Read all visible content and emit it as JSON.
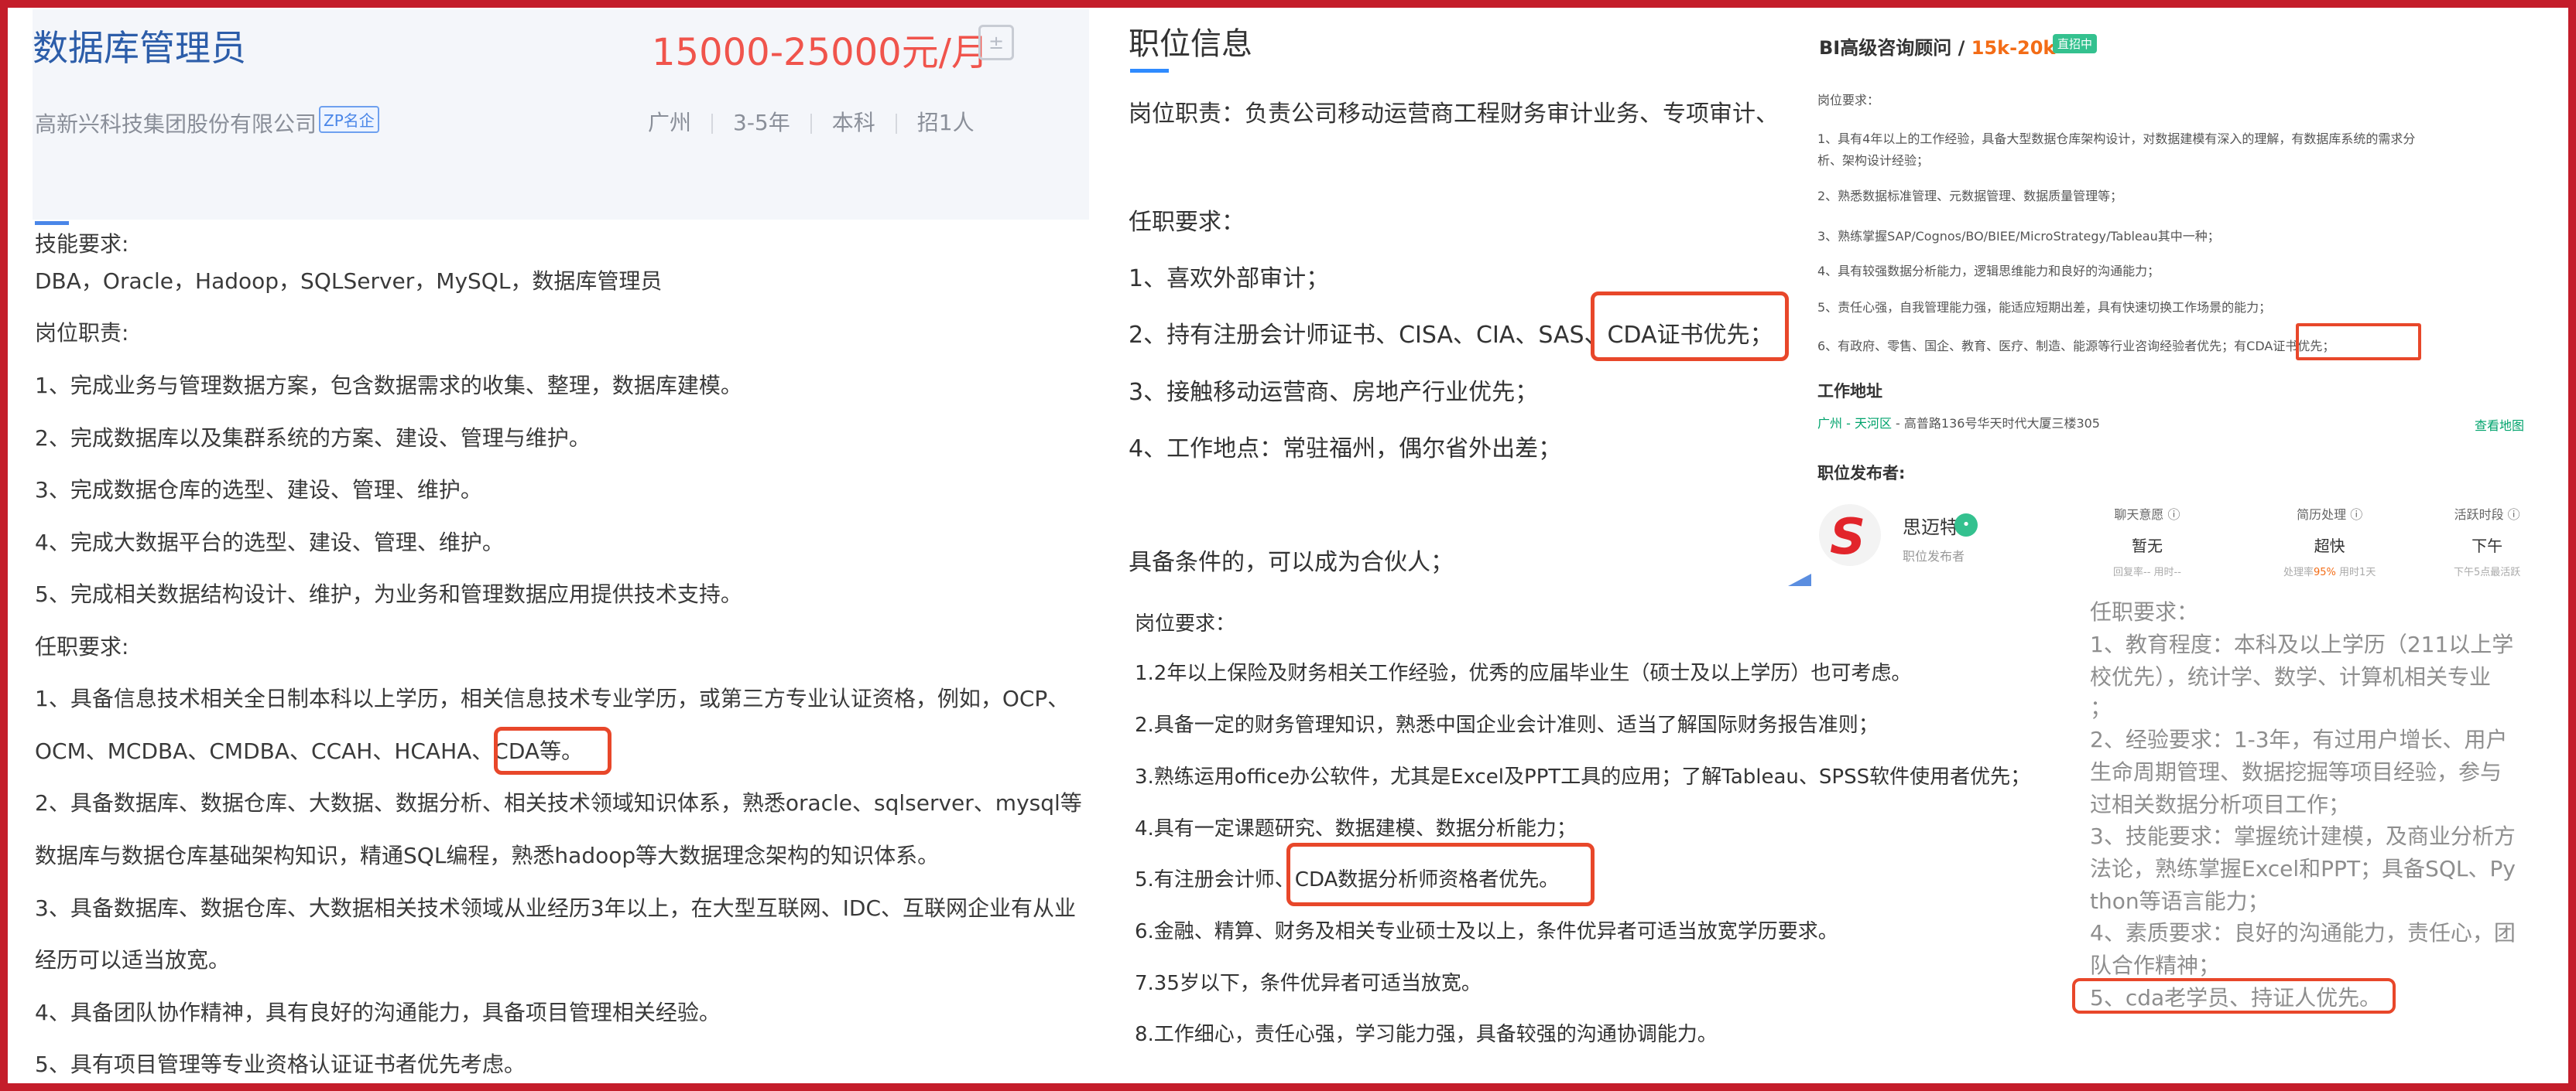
{
  "panel_a": {
    "title": "数据库管理员",
    "salary": "15000-25000元/月",
    "calc_icon": "calculator-icon",
    "company": "高新兴科技集团股份有限公司",
    "badge": "ZP名企",
    "meta": [
      "广州",
      "3-5年",
      "本科",
      "招1人"
    ],
    "lines": [
      "技能要求:",
      "DBA，Oracle，Hadoop，SQLServer，MySQL，数据库管理员",
      "岗位职责:",
      "1、完成业务与管理数据方案，包含数据需求的收集、整理，数据库建模。",
      "2、完成数据库以及集群系统的方案、建设、管理与维护。",
      "3、完成数据仓库的选型、建设、管理、维护。",
      "4、完成大数据平台的选型、建设、管理、维护。",
      "5、完成相关数据结构设计、维护，为业务和管理数据应用提供技术支持。",
      "任职要求:",
      "1、具备信息技术相关全日制本科以上学历，相关信息技术专业学历，或第三方专业认证资格，例如，OCP、",
      "OCM、MCDBA、CMDBA、CCAH、HCAHA、CDA等。",
      "2、具备数据库、数据仓库、大数据、数据分析、相关技术领域知识体系，熟悉oracle、sqlserver、mysql等",
      "数据库与数据仓库基础架构知识，精通SQL编程，熟悉hadoop等大数据理念架构的知识体系。",
      "3、具备数据库、数据仓库、大数据相关技术领域从业经历3年以上，在大型互联网、IDC、互联网企业有从业",
      "经历可以适当放宽。",
      "4、具备团队协作精神，具有良好的沟通能力，具备项目管理相关经验。",
      "5、具有项目管理等专业资格认证证书者优先考虑。"
    ]
  },
  "panel_b": {
    "title": "职位信息",
    "lines": [
      "岗位职责：负责公司移动运营商工程财务审计业务、专项审计、",
      "任职要求：",
      "1、喜欢外部审计；",
      "2、持有注册会计师证书、CISA、CIA、SAS、CDA证书优先；",
      "3、接触移动运营商、房地产行业优先；",
      "4、工作地点：常驻福州，偶尔省外出差；",
      "具备条件的，可以成为合伙人；"
    ]
  },
  "panel_b2": {
    "lines": [
      "岗位要求：",
      "1.2年以上保险及财务相关工作经验，优秀的应届毕业生（硕士及以上学历）也可考虑。",
      "2.具备一定的财务管理知识，熟悉中国企业会计准则、适当了解国际财务报告准则；",
      "3.熟练运用office办公软件，尤其是Excel及PPT工具的应用；了解Tableau、SPSS软件使用者优先；",
      "4.具有一定课题研究、数据建模、数据分析能力；",
      "5.有注册会计师、CDA数据分析师资格者优先。",
      "6.金融、精算、财务及相关专业硕士及以上，条件优异者可适当放宽学历要求。",
      "7.35岁以下，条件优异者可适当放宽。",
      "8.工作细心，责任心强，学习能力强，具备较强的沟通协调能力。"
    ]
  },
  "panel_c": {
    "job_title": "BI高级咨询顾问 / ",
    "salary": "15k-20k",
    "tag": "直招中",
    "lines": [
      "岗位要求：",
      "1、具有4年以上的工作经验，具备大型数据仓库架构设计，对数据建模有深入的理解，有数据库系统的需求分",
      "析、架构设计经验；",
      "2、熟悉数据标准管理、元数据管理、数据质量管理等；",
      "3、熟练掌握SAP/Cognos/BO/BIEE/MicroStrategy/Tableau其中一种；",
      "4、具有较强数据分析能力，逻辑思维能力和良好的沟通能力；",
      "5、责任心强，自我管理能力强，能适应短期出差，具有快速切换工作场景的能力；",
      "6、有政府、零售、国企、教育、医疗、制造、能源等行业咨询经验者优先；有CDA证书优先；"
    ],
    "address_label": "工作地址",
    "address_city": "广州 - 天河区",
    "address_detail": " - 高普路136号华天时代大厦三楼305",
    "map_link": "查看地图",
    "publisher_label": "职位发布者:",
    "publisher_name": "思迈特",
    "publisher_role": "职位发布者",
    "stats": [
      {
        "k": "聊天意愿 ⓘ",
        "v": "暂无",
        "n1": "回复率-- 用时--",
        "n2": ""
      },
      {
        "k": "简历处理 ⓘ",
        "v": "超快",
        "n1": "处理率",
        "n2": "95%",
        "n3": " 用时1天"
      },
      {
        "k": "活跃时段 ⓘ",
        "v": "下午",
        "n1": "下午5点最活跃",
        "n2": ""
      }
    ]
  },
  "panel_d": {
    "lines": [
      "任职要求：",
      "1、教育程度：本科及以上学历（211以上学",
      "校优先），统计学、数学、计算机相关专业",
      "；",
      "2、经验要求：1-3年，有过用户增长、用户",
      "生命周期管理、数据挖掘等项目经验，参与",
      "过相关数据分析项目工作；",
      "3、技能要求：掌握统计建模，及商业分析方",
      "法论，熟练掌握Excel和PPT；具备SQL、Py",
      "thon等语言能力；",
      "4、素质要求：良好的沟通能力，责任心，团",
      "队合作精神；",
      "5、cda老学员、持证人优先。"
    ]
  },
  "colors": {
    "frame": "#c41d2a",
    "highlight": "#e8472a",
    "title_blue": "#2c5da9",
    "salary_red": "#f0544c",
    "orange": "#f36c16",
    "green": "#34c18f"
  }
}
